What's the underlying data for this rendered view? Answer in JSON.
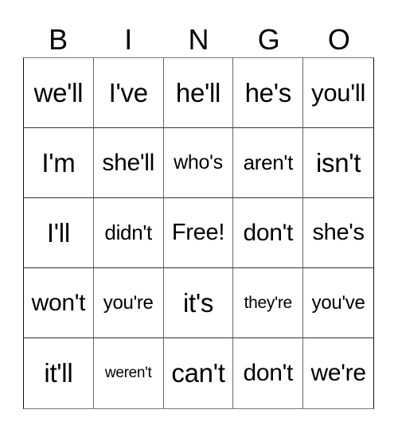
{
  "header": [
    "B",
    "I",
    "N",
    "G",
    "O"
  ],
  "cells": [
    [
      {
        "text": "we'll",
        "size": 33
      },
      {
        "text": "I've",
        "size": 33
      },
      {
        "text": "he'll",
        "size": 33
      },
      {
        "text": "he's",
        "size": 33
      },
      {
        "text": "you'll",
        "size": 31
      }
    ],
    [
      {
        "text": "I'm",
        "size": 33
      },
      {
        "text": "she'll",
        "size": 30
      },
      {
        "text": "who's",
        "size": 25
      },
      {
        "text": "aren't",
        "size": 26
      },
      {
        "text": "isn't",
        "size": 33
      }
    ],
    [
      {
        "text": "I'll",
        "size": 33
      },
      {
        "text": "didn't",
        "size": 26
      },
      {
        "text": "Free!",
        "size": 29
      },
      {
        "text": "don't",
        "size": 30
      },
      {
        "text": "she's",
        "size": 29
      }
    ],
    [
      {
        "text": "won't",
        "size": 30
      },
      {
        "text": "you're",
        "size": 24
      },
      {
        "text": "it's",
        "size": 33
      },
      {
        "text": "they're",
        "size": 21
      },
      {
        "text": "you've",
        "size": 24
      }
    ],
    [
      {
        "text": "it'll",
        "size": 33
      },
      {
        "text": "weren't",
        "size": 19
      },
      {
        "text": "can't",
        "size": 33
      },
      {
        "text": "don't",
        "size": 30
      },
      {
        "text": "we're",
        "size": 30
      }
    ]
  ]
}
